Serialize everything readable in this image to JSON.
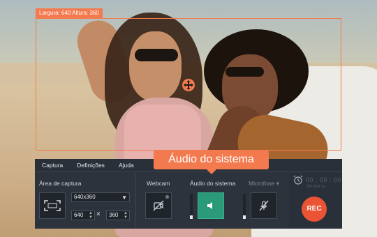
{
  "capture": {
    "size_label": "Largura: 640 Altura: 360"
  },
  "tooltip": {
    "text": "Áudio do sistema"
  },
  "menu": {
    "items": [
      "Captura",
      "Definições",
      "Ajuda"
    ]
  },
  "capture_area": {
    "title": "Área de captura",
    "resolution": "640x360",
    "width": "640",
    "height": "360",
    "times_symbol": "×"
  },
  "sources": {
    "webcam_label": "Webcam",
    "system_audio_label": "Áudio do sistema",
    "microphone_label": "Microfone ▾",
    "system_audio_level": 0.15,
    "microphone_level": 0.15
  },
  "recording": {
    "timer": "00 : 00 : 00",
    "units": "hh    mm    ss",
    "rec_label": "REC"
  },
  "colors": {
    "accent": "#f37a4e",
    "active_source": "#2a9a78",
    "rec": "#ea5434",
    "panel": "#2d333d"
  },
  "icons": {
    "move": "move-arrows-icon",
    "capture_area": "fullscreen-frame-icon",
    "webcam": "webcam-off-icon",
    "speaker": "speaker-icon",
    "microphone": "microphone-off-icon",
    "alarm": "alarm-clock-icon",
    "gear": "gear-icon"
  }
}
